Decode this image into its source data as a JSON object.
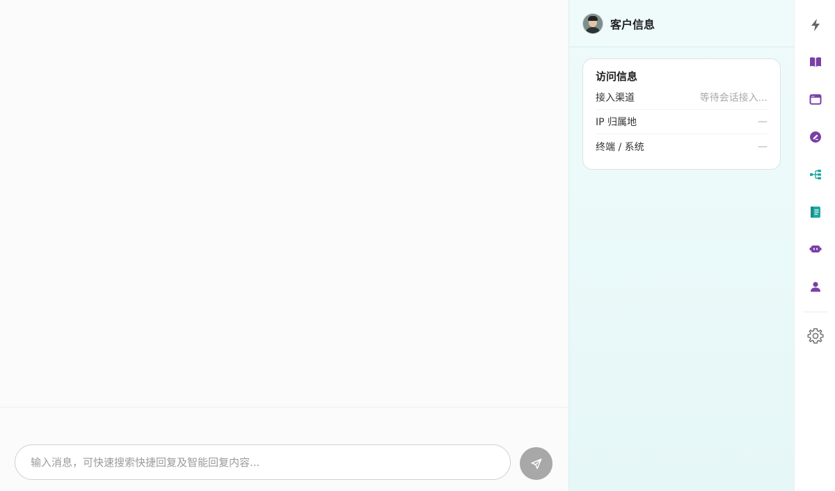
{
  "composer": {
    "placeholder": "输入消息，可快速搜索快捷回复及智能回复内容..."
  },
  "customer_panel": {
    "title": "客户信息",
    "visit_info": {
      "title": "访问信息",
      "rows": [
        {
          "label": "接入渠道",
          "value": "等待会话接入..."
        },
        {
          "label": "IP 归属地",
          "value": "—"
        },
        {
          "label": "终端 / 系统",
          "value": "—"
        }
      ]
    }
  },
  "rail": {
    "items": [
      {
        "icon": "lightning-icon",
        "color": "#666666"
      },
      {
        "icon": "book-icon",
        "color": "#7b3fa6"
      },
      {
        "icon": "browser-window-icon",
        "color": "#7b3fa6"
      },
      {
        "icon": "edit-badge-icon",
        "color": "#7b3fa6"
      },
      {
        "icon": "tree-structure-icon",
        "color": "#1fa8a0"
      },
      {
        "icon": "document-icon",
        "color": "#1fa8a0"
      },
      {
        "icon": "robot-icon",
        "color": "#7b3fa6"
      },
      {
        "icon": "user-icon",
        "color": "#7b3fa6"
      },
      {
        "icon": "gear-icon",
        "color": "#777777"
      }
    ]
  }
}
